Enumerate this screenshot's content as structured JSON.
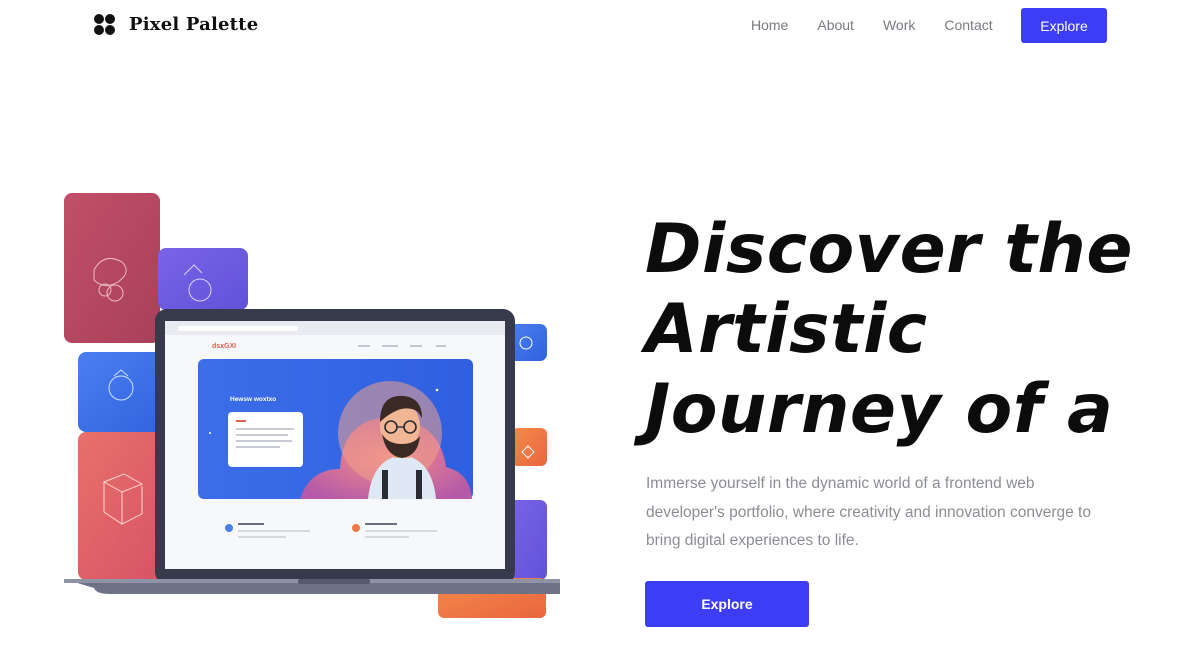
{
  "brand": {
    "name": "Pixel Palette",
    "icon": "four-dots-logo-icon"
  },
  "nav": {
    "links": [
      "Home",
      "About",
      "Work",
      "Contact"
    ],
    "cta": "Explore"
  },
  "hero": {
    "title_lines": [
      "Discover the",
      "Artistic",
      "Journey of a"
    ],
    "subtitle": "Immerse yourself in the dynamic world of a frontend web developer's portfolio, where creativity and innovation converge to bring digital experiences to life.",
    "cta": "Explore"
  },
  "colors": {
    "accent": "#3d3df5",
    "text": "#0c0c0c",
    "muted": "#8a8d93",
    "card_rose": "#b5485e",
    "card_purple": "#6a5ae0",
    "card_blue": "#3e73ec",
    "card_coral": "#e0606a",
    "card_orange": "#f07a45"
  },
  "illustration": {
    "subject": "laptop-with-portfolio-illustration",
    "screen_brand": "dsxGXI",
    "screen_banner": "Hewsw woxtxo"
  }
}
